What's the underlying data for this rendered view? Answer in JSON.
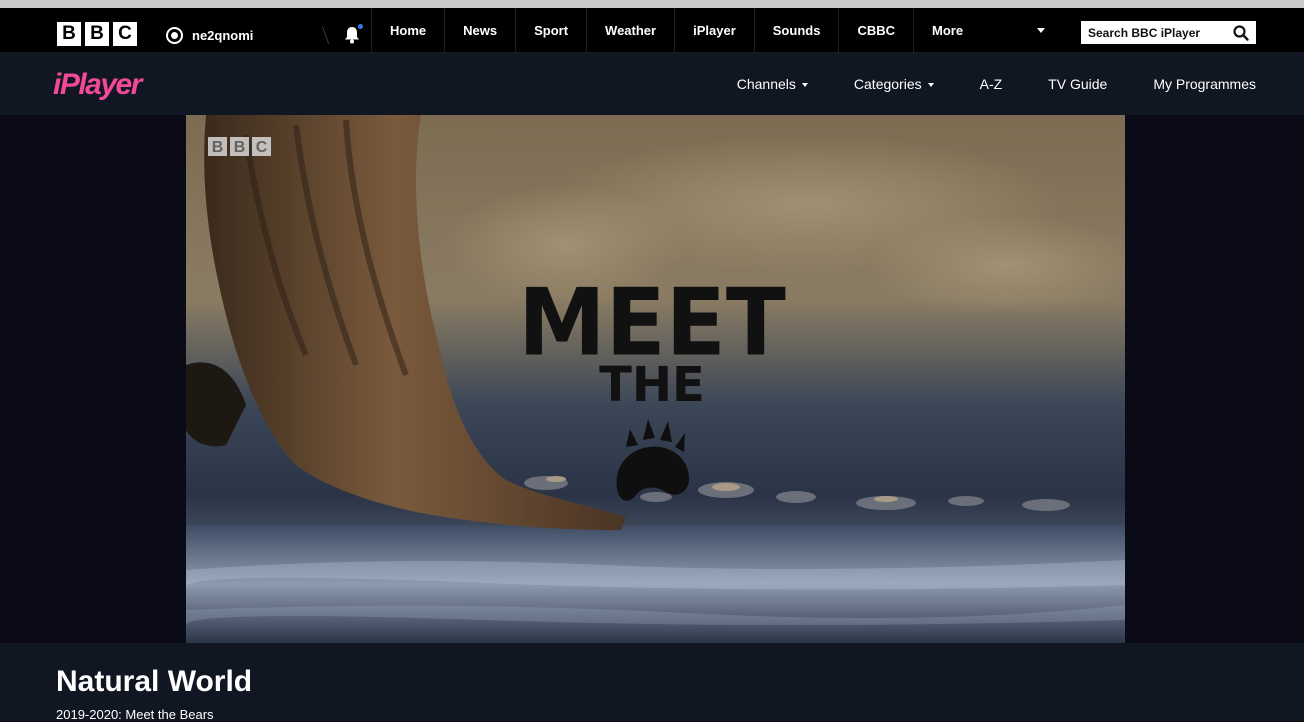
{
  "global_bar": {
    "logo_letters": [
      "B",
      "B",
      "C"
    ],
    "account_name": "ne2qnomi",
    "nav": [
      "Home",
      "News",
      "Sport",
      "Weather",
      "iPlayer",
      "Sounds",
      "CBBC",
      "More"
    ],
    "search_placeholder": "Search BBC iPlayer",
    "notification_dot_color": "#2b7de9"
  },
  "iplayer_bar": {
    "logo_text": "iPlayer",
    "logo_color": "#f54997",
    "nav": {
      "channels": "Channels",
      "categories": "Categories",
      "az": "A-Z",
      "tv_guide": "TV Guide",
      "my_programmes": "My Programmes"
    }
  },
  "player": {
    "watermark": "BBC",
    "title_card": [
      "MEET",
      "THE"
    ],
    "title_card_icon": "bear-paw-icon"
  },
  "programme": {
    "title": "Natural World",
    "subtitle": "2019-2020: Meet the Bears"
  }
}
